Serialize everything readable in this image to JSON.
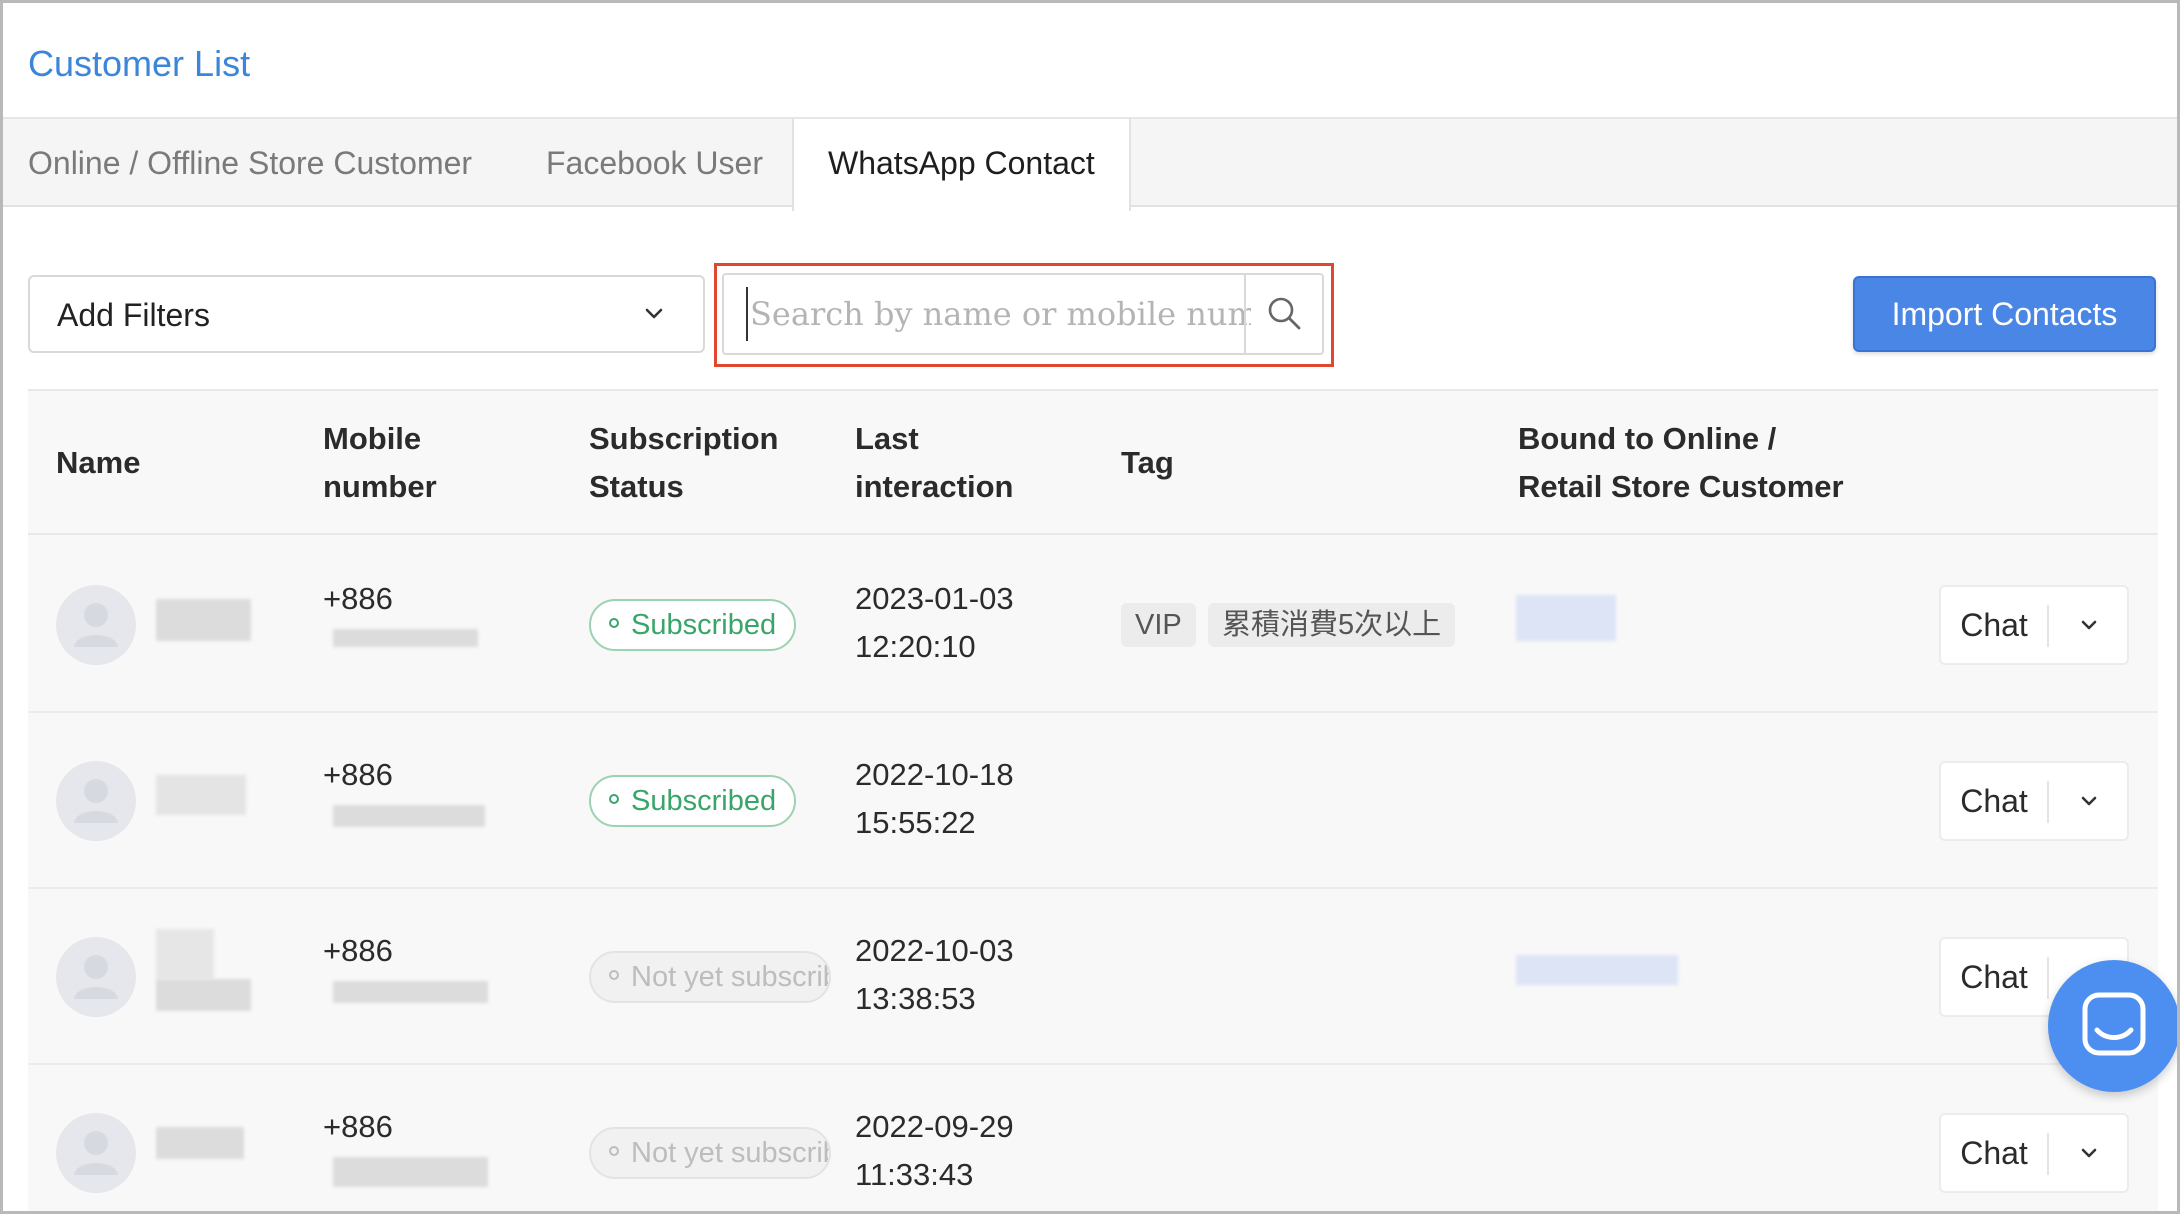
{
  "page": {
    "title": "Customer List"
  },
  "tabs": [
    {
      "label": "Online / Offline Store Customer",
      "active": false
    },
    {
      "label": "Facebook User",
      "active": false
    },
    {
      "label": "WhatsApp Contact",
      "active": true
    }
  ],
  "toolbar": {
    "filter_label": "Add Filters",
    "search_placeholder": "Search by name or mobile number",
    "search_value": "",
    "import_label": "Import Contacts"
  },
  "table": {
    "headers": {
      "name": "Name",
      "mobile_line1": "Mobile",
      "mobile_line2": "number",
      "subscription_line1": "Subscription",
      "subscription_line2": "Status",
      "last_line1": "Last",
      "last_line2": "interaction",
      "tag": "Tag",
      "bound_line1": "Bound to Online /",
      "bound_line2": "Retail Store Customer"
    },
    "rows": [
      {
        "mobile_prefix": "+886",
        "status": "Subscribed",
        "date": "2023-01-03",
        "time": "12:20:10",
        "tags": [
          "VIP",
          "累積消費5次以上"
        ],
        "chat_label": "Chat"
      },
      {
        "mobile_prefix": "+886",
        "status": "Subscribed",
        "date": "2022-10-18",
        "time": "15:55:22",
        "tags": [],
        "chat_label": "Chat"
      },
      {
        "mobile_prefix": "+886",
        "status": "Not yet subscribed",
        "date": "2022-10-03",
        "time": "13:38:53",
        "tags": [],
        "chat_label": "Chat"
      },
      {
        "mobile_prefix": "+886",
        "status": "Not yet subscribed",
        "date": "2022-09-29",
        "time": "11:33:43",
        "tags": [],
        "chat_label": "Chat"
      }
    ]
  },
  "colors": {
    "accent": "#3b86d9",
    "primary_button": "#4a86e6",
    "highlight_border": "#e0472f",
    "subscribed": "#3aa56a",
    "messenger": "#4d8ff0"
  },
  "icons": [
    "chevron-down-icon",
    "search-icon",
    "user-avatar-icon",
    "messenger-icon"
  ]
}
